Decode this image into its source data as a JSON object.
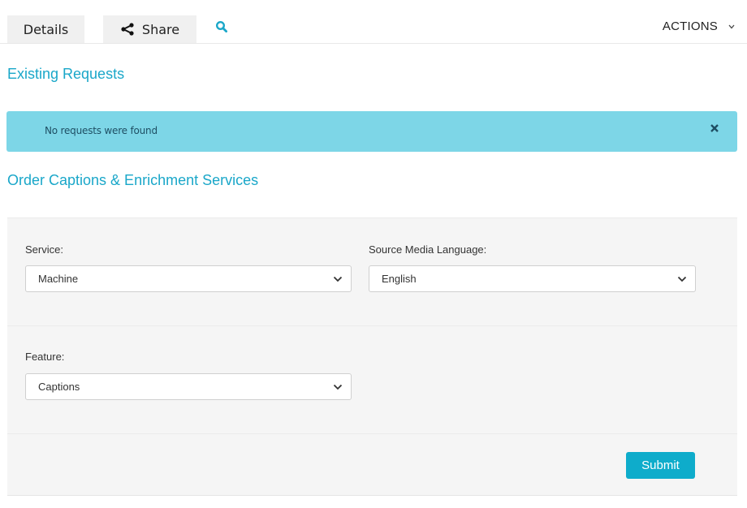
{
  "tabs": {
    "details_label": "Details",
    "share_label": "Share",
    "search_icon": "search-icon"
  },
  "actions": {
    "label": "ACTIONS"
  },
  "existing_requests": {
    "title": "Existing Requests",
    "alert_text": "No requests were found"
  },
  "order": {
    "title": "Order Captions & Enrichment Services",
    "service": {
      "label": "Service:",
      "value": "Machine"
    },
    "source_language": {
      "label": "Source Media Language:",
      "value": "English"
    },
    "feature": {
      "label": "Feature:",
      "value": "Captions"
    },
    "submit_label": "Submit"
  },
  "colors": {
    "accent": "#1aa7c9",
    "alert_bg": "#7dd6e7",
    "button_bg": "#0eaccb",
    "panel_bg": "#f5f5f5"
  }
}
